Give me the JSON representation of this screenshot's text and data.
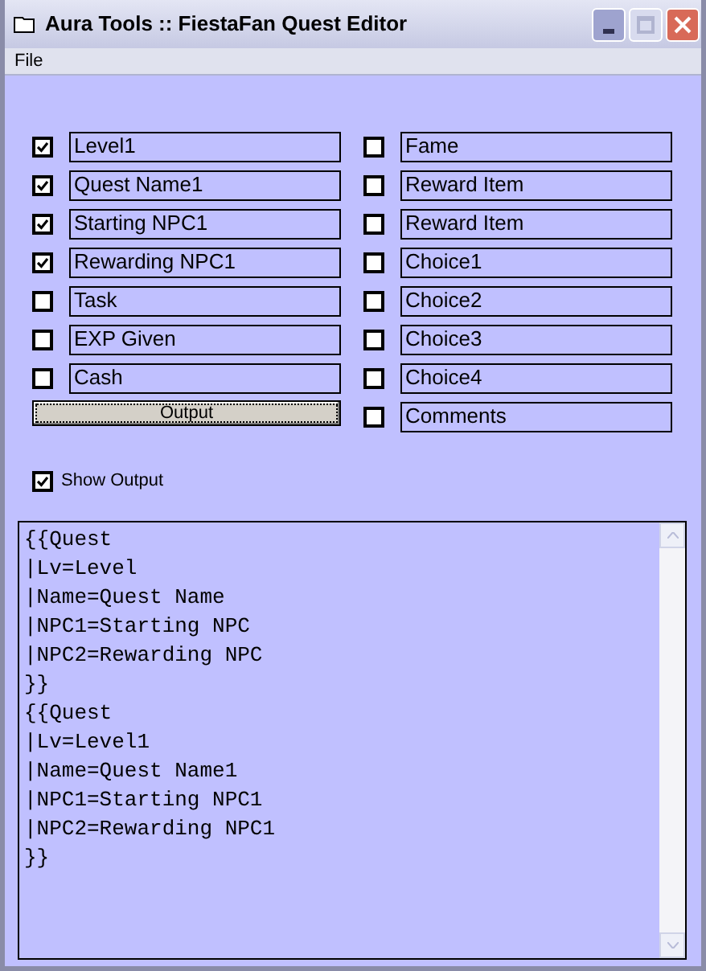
{
  "window": {
    "title": "Aura Tools :: FiestaFan Quest Editor"
  },
  "menu": [
    "File"
  ],
  "left_fields": [
    {
      "value": "Level1",
      "checked": true
    },
    {
      "value": "Quest Name1",
      "checked": true
    },
    {
      "value": "Starting NPC1",
      "checked": true
    },
    {
      "value": "Rewarding NPC1",
      "checked": true
    },
    {
      "value": "Task",
      "checked": false
    },
    {
      "value": "EXP Given",
      "checked": false
    },
    {
      "value": "Cash",
      "checked": false
    }
  ],
  "output_button": "Output",
  "right_fields": [
    {
      "value": "Fame",
      "checked": false
    },
    {
      "value": "Reward Item",
      "checked": false
    },
    {
      "value": "Reward Item",
      "checked": false
    },
    {
      "value": "Choice1",
      "checked": false
    },
    {
      "value": "Choice2",
      "checked": false
    },
    {
      "value": "Choice3",
      "checked": false
    },
    {
      "value": "Choice4",
      "checked": false
    },
    {
      "value": "Comments",
      "checked": false
    }
  ],
  "show_output": {
    "label": "Show Output",
    "checked": true
  },
  "output": [
    "{{Quest",
    "|Lv=Level",
    "|Name=Quest Name",
    "|NPC1=Starting NPC",
    "|NPC2=Rewarding NPC",
    "}}",
    "{{Quest",
    "|Lv=Level1",
    "|Name=Quest Name1",
    "|NPC1=Starting NPC1",
    "|NPC2=Rewarding NPC1",
    "}}"
  ]
}
